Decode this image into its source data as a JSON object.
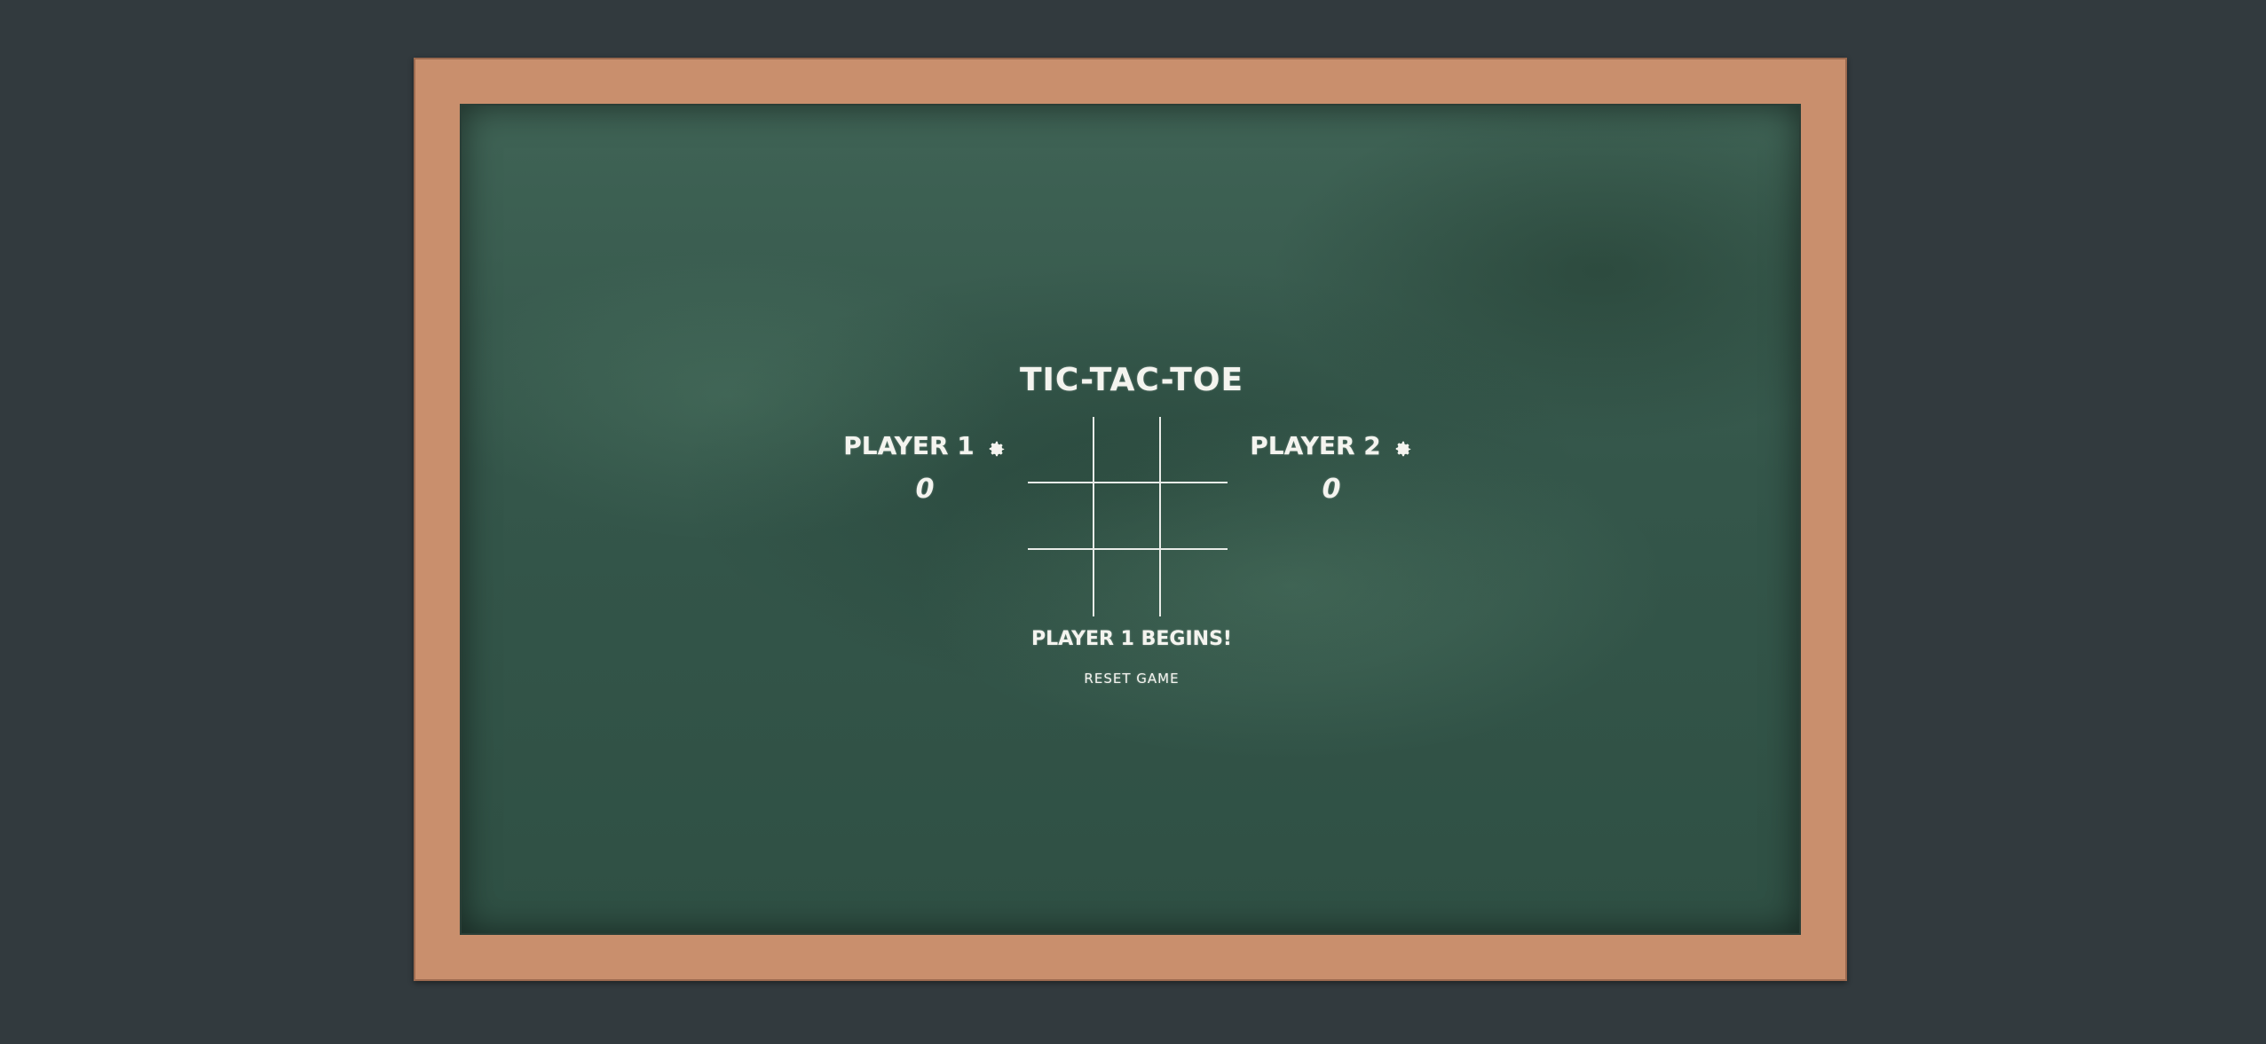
{
  "game": {
    "title": "TIC-TAC-TOE",
    "status": "PLAYER 1 BEGINS!",
    "reset_label": "RESET GAME"
  },
  "players": [
    {
      "name": "PLAYER 1",
      "score": "0",
      "settings_icon": "gear-icon"
    },
    {
      "name": "PLAYER 2",
      "score": "0",
      "settings_icon": "gear-icon"
    }
  ],
  "board": {
    "cells": [
      "",
      "",
      "",
      "",
      "",
      "",
      "",
      "",
      ""
    ]
  },
  "colors": {
    "background": "#323a3e",
    "frame": "#c98f6d",
    "chalkboard": "#3a5d4f",
    "chalk": "#f4f4ef"
  }
}
